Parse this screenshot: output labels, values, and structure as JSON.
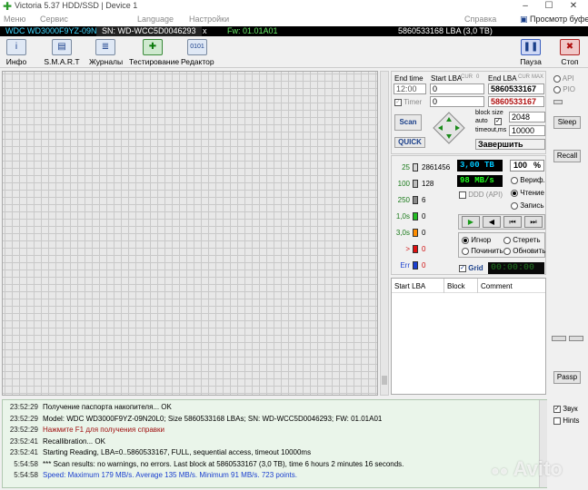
{
  "window": {
    "title": "Victoria 5.37 HDD/SSD | Device 1",
    "controls": [
      "–",
      "☐",
      "✕"
    ]
  },
  "menu": {
    "items": [
      "Меню",
      "Сервис",
      "Language",
      "Настройки"
    ],
    "help": "Справка",
    "buffer": "Просмотр буфера"
  },
  "device": {
    "model": "WDC WD3000F9YZ-09N20L0",
    "serial": "SN: WD-WCC5D0046293",
    "close": "x",
    "firmware": "Fw: 01.01A01",
    "capacity": "5860533168 LBA (3,0 TB)"
  },
  "toolbar": {
    "info": "Инфо",
    "smart": "S.M.A.R.T",
    "logs": "Журналы",
    "test": "Тестирование",
    "editor": "Редактор",
    "pause": "Пауза",
    "stop": "Стоп"
  },
  "scan": {
    "end_time_label": "End time",
    "start_lba_label": "Start LBA",
    "cur_label": "CUR",
    "zero_label": "0",
    "end_lba_label": "End LBA",
    "max_label": "MAX",
    "time_value": "12:00",
    "timer_label": "Timer",
    "start_lba_value": "0",
    "start_lba_cur": "0",
    "end_lba_value": "5860533167",
    "end_lba_cur": "5860533167",
    "block_size_label": "block size",
    "auto_label": "auto",
    "block_size_value": "2048",
    "timeout_label": "timeout,ms",
    "timeout_value": "10000",
    "scan_button": "Scan",
    "quick_button": "QUICK",
    "status_value": "Завершить"
  },
  "stats": {
    "levels": [
      {
        "label": "25",
        "count": "2861456",
        "color": "#d8d8d8"
      },
      {
        "label": "100",
        "count": "128",
        "color": "#bdbdbd"
      },
      {
        "label": "250",
        "count": "6",
        "color": "#8a8a8a"
      },
      {
        "label": "1,0s",
        "count": "0",
        "color": "#22bb22"
      },
      {
        "label": "3,0s",
        "count": "0",
        "color": "#ff8c00"
      },
      {
        "label": ">",
        "count": "0",
        "color": "#e01010"
      },
      {
        "label": "Err",
        "count": "0",
        "color": "#1a3fcf"
      }
    ],
    "size_done": "3,00 TB",
    "percent": "100",
    "percent_sign": "%",
    "speed": "98 MB/s",
    "ddd_label": "DDD (API)",
    "verify_label": "Вериф.",
    "read_label": "Чтение",
    "write_label": "Запись",
    "ignore_label": "Игнор",
    "erase_label": "Стереть",
    "repair_label": "Починить",
    "refresh_label": "Обновить",
    "grid_label": "Grid",
    "elapsed": "00:00:00"
  },
  "table": {
    "col1": "Start LBA",
    "col2": "Block",
    "col3": "Comment"
  },
  "side": {
    "api_label": "API",
    "pio_label": "PIO",
    "sleep": "Sleep",
    "recall": "Recall",
    "passp": "Passp",
    "sound_label": "Звук",
    "hints_label": "Hints"
  },
  "log": [
    {
      "time": "23:52:29",
      "text": "Получение паспорта накопителя... OK",
      "color": "#000000"
    },
    {
      "time": "23:52:29",
      "text": "Model: WDC WD3000F9YZ-09N20L0; Size 5860533168 LBAs; SN: WD-WCC5D0046293; FW: 01.01A01",
      "color": "#000000"
    },
    {
      "time": "23:52:29",
      "text": "Нажмите F1 для получения справки",
      "color": "#a01010"
    },
    {
      "time": "23:52:41",
      "text": "Recallibration... OK",
      "color": "#000000"
    },
    {
      "time": "23:52:41",
      "text": "Starting Reading, LBA=0..5860533167, FULL, sequential access, timeout 10000ms",
      "color": "#000000"
    },
    {
      "time": "5:54:58",
      "text": "*** Scan results: no warnings, no errors. Last block at 5860533167 (3,0 TB), time 6 hours 2 minutes 16 seconds.",
      "color": "#000000"
    },
    {
      "time": "5:54:58",
      "text": "Speed: Maximum 179 MB/s. Average 135 MB/s. Minimum 91 MB/s. 723 points.",
      "color": "#1a3fcf"
    }
  ],
  "watermark": "Avito"
}
